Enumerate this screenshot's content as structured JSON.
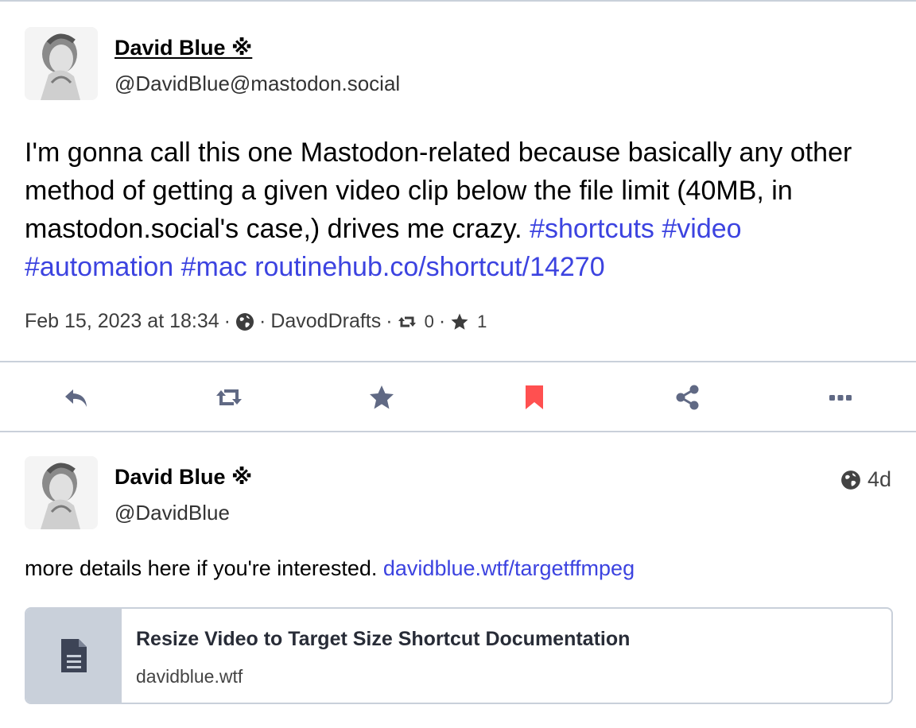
{
  "focused_status": {
    "author": {
      "display_name": "David Blue ※",
      "handle": "@DavidBlue@mastodon.social"
    },
    "content_text": "I'm gonna call this one Mastodon-related because basically any other method of getting a given video clip below the file limit (40MB, in mastodon.social's case,) drives me crazy. ",
    "hashtags": [
      "#shortcuts",
      "#video",
      "#automation",
      "#mac"
    ],
    "link": "routinehub.co/shortcut/14270",
    "meta": {
      "timestamp": "Feb 15, 2023 at 18:34",
      "separator": "·",
      "visibility_icon": "globe-icon",
      "application": "DavodDrafts",
      "boost_count": "0",
      "favourite_count": "1"
    }
  },
  "action_bar": {
    "items": [
      {
        "name": "reply",
        "icon": "reply-icon",
        "color": "#606984"
      },
      {
        "name": "boost",
        "icon": "retweet-icon",
        "color": "#606984"
      },
      {
        "name": "favourite",
        "icon": "star-icon",
        "color": "#606984"
      },
      {
        "name": "bookmark",
        "icon": "bookmark-icon",
        "color": "#ff5050"
      },
      {
        "name": "share",
        "icon": "share-icon",
        "color": "#606984"
      },
      {
        "name": "more",
        "icon": "ellipsis-icon",
        "color": "#606984"
      }
    ]
  },
  "reply_status": {
    "author": {
      "display_name": "David Blue ※",
      "handle": "@DavidBlue"
    },
    "visibility_icon": "globe-icon",
    "relative_time": "4d",
    "content_text": "more details here if you're interested. ",
    "link": "davidblue.wtf/targetffmpeg",
    "card": {
      "icon": "document-icon",
      "title": "Resize Video to Target Size Shortcut Documentation",
      "host": "davidblue.wtf"
    }
  },
  "colors": {
    "link": "#3c43e0",
    "divider": "#c9d0da",
    "icon": "#606984",
    "bookmark_active": "#ff5050"
  }
}
